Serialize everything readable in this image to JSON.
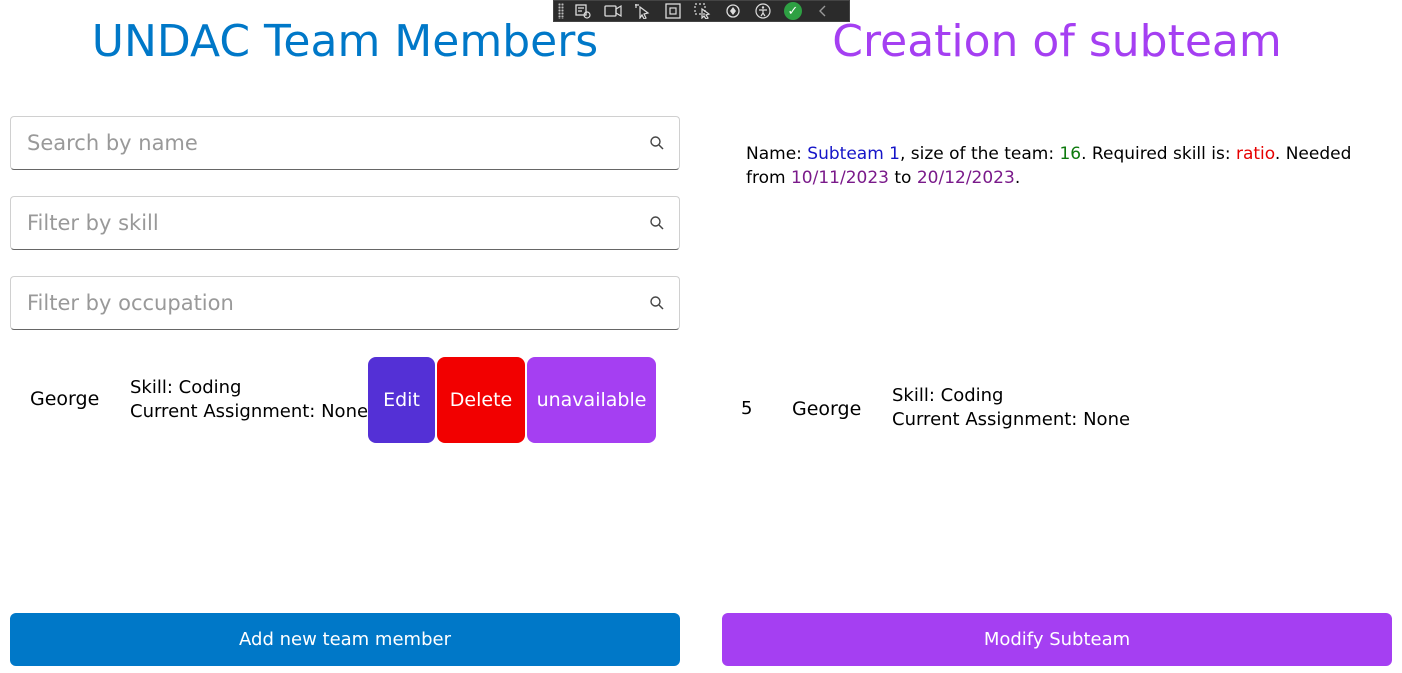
{
  "left_panel": {
    "title": "UNDAC Team Members",
    "search_name_placeholder": "Search by name",
    "filter_skill_placeholder": "Filter by skill",
    "filter_occupation_placeholder": "Filter by occupation",
    "members": [
      {
        "name": "George",
        "skill_line": "Skill: Coding",
        "assignment_line": "Current Assignment: None",
        "edit_label": "Edit",
        "delete_label": "Delete",
        "unavailable_label": "unavailable"
      }
    ],
    "add_button_label": "Add new team member"
  },
  "right_panel": {
    "title": "Creation of subteam",
    "description": {
      "name_prefix": "Name: ",
      "name_value": "Subteam 1",
      "size_prefix": ", size of the team: ",
      "size_value": "16",
      "skill_prefix": ". Required skill is: ",
      "skill_value": "ratio",
      "needed_prefix": ". Needed from ",
      "from_date": "10/11/2023",
      "to_word": " to ",
      "to_date": "20/12/2023",
      "end": "."
    },
    "subteam_members": [
      {
        "index": "5",
        "name": "George",
        "skill_line": "Skill: Coding",
        "assignment_line": "Current Assignment: None"
      }
    ],
    "modify_button_label": "Modify Subteam"
  },
  "colors": {
    "left_accent": "#0078c8",
    "right_accent": "#a53ff2",
    "edit": "#5430d6",
    "delete": "#f20000",
    "unavailable": "#a53ff2"
  },
  "devbar_icons": [
    "grip-icon",
    "live-tree-icon",
    "record-icon",
    "select-element-icon",
    "display-layout-adorners-icon",
    "track-focus-icon",
    "hot-reload-icon",
    "accessibility-icon",
    "check-icon",
    "collapse-icon"
  ]
}
